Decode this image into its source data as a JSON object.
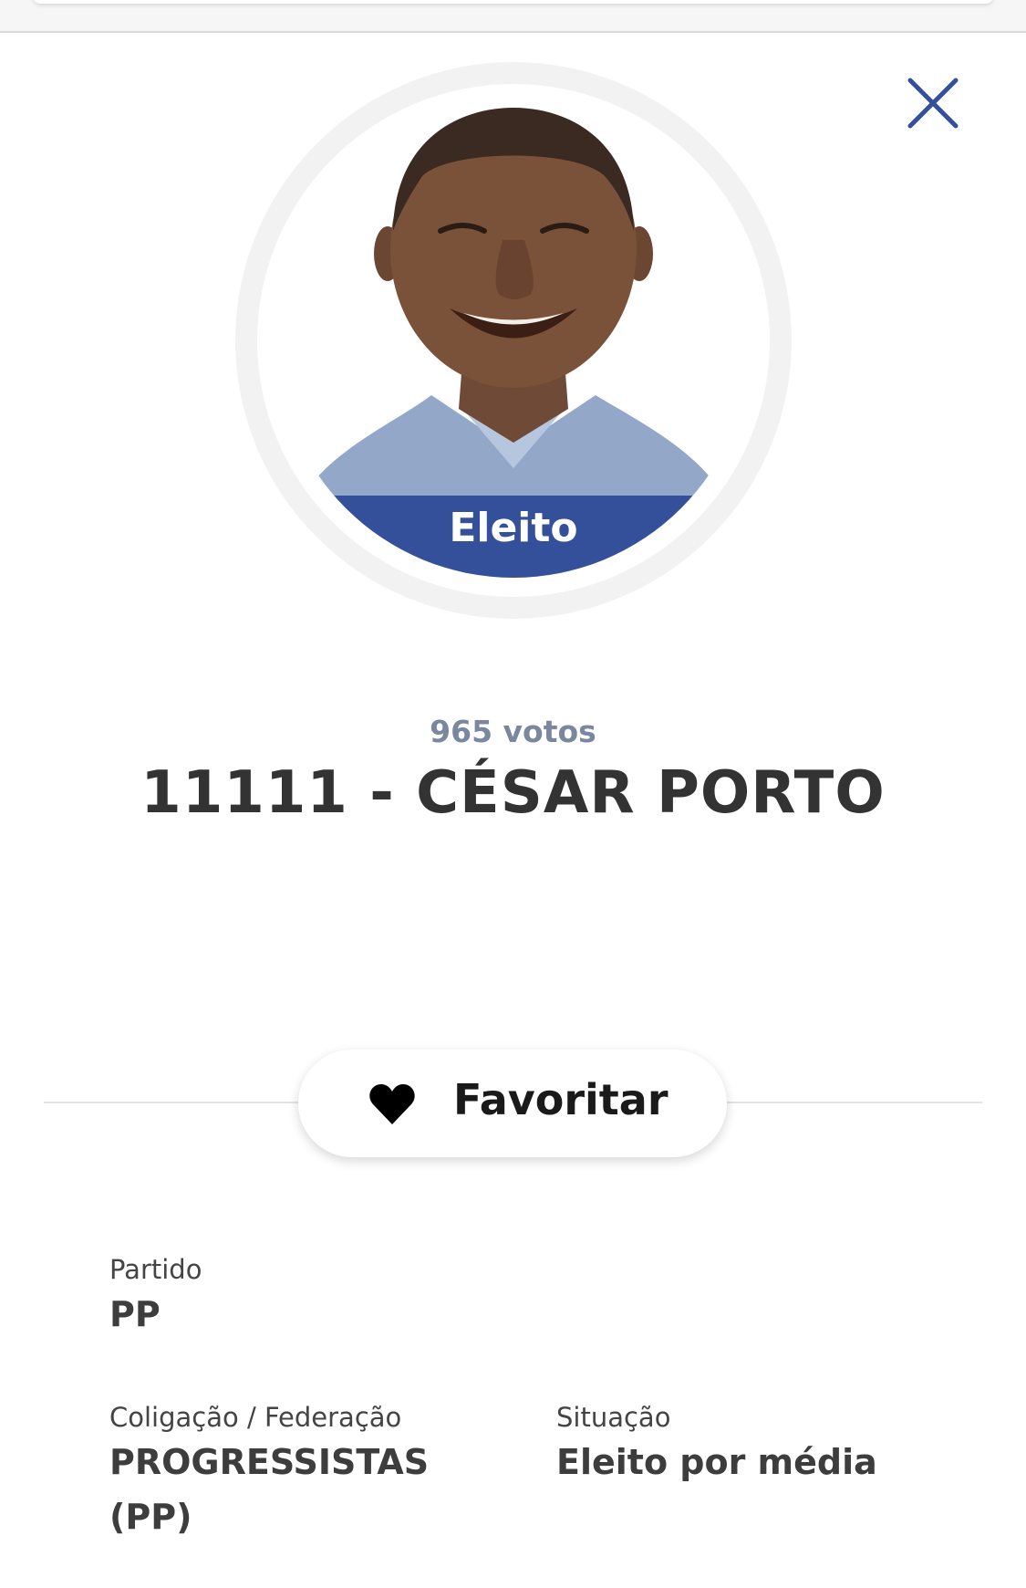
{
  "header": {
    "close_icon": "close-icon",
    "accent_color": "#34509b"
  },
  "candidate": {
    "photo_alt": "Foto do candidato",
    "status_badge": "Eleito",
    "votes": "965 votos",
    "title": "11111 - CÉSAR PORTO"
  },
  "favorite": {
    "label": "Favoritar",
    "icon": "heart-icon"
  },
  "details": {
    "party_label": "Partido",
    "party_value": "PP",
    "coalition_label": "Coligação / Federação",
    "coalition_value_line1": "PROGRESSISTAS",
    "coalition_value_line2": "(PP)",
    "status_label": "Situação",
    "status_value": "Eleito por média"
  }
}
